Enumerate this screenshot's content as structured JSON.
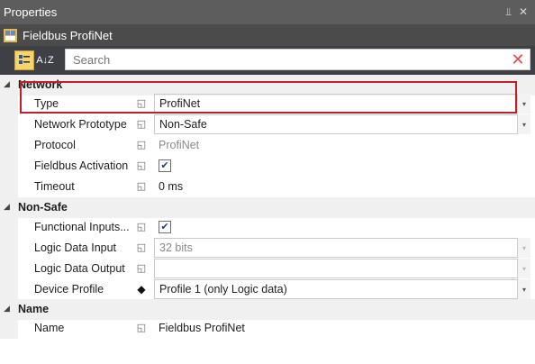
{
  "window": {
    "title": "Properties",
    "pin_glyph": "⫫",
    "close_glyph": "✕"
  },
  "object": {
    "name": "Fieldbus ProfiNet"
  },
  "toolbar": {
    "sort_label": "A↓Z"
  },
  "search": {
    "placeholder": "Search",
    "value": ""
  },
  "grid": {
    "categories": [
      {
        "label": "Network"
      },
      {
        "label": "Non-Safe"
      },
      {
        "label": "Name"
      }
    ],
    "network": [
      {
        "name": "Type",
        "value": "ProfiNet"
      },
      {
        "name": "Network Prototype",
        "value": "Non-Safe"
      },
      {
        "name": "Protocol",
        "value": "ProfiNet"
      },
      {
        "name": "Fieldbus Activation",
        "value": ""
      },
      {
        "name": "Timeout",
        "value": "0 ms"
      }
    ],
    "nonsafe": [
      {
        "name": "Functional Inputs...",
        "value": ""
      },
      {
        "name": "Logic Data Input",
        "value": "32 bits"
      },
      {
        "name": "Logic Data Output",
        "value": ""
      },
      {
        "name": "Device Profile",
        "value": "Profile 1 (only Logic data)"
      }
    ],
    "name": [
      {
        "name": "Name",
        "value": "Fieldbus ProfiNet"
      }
    ]
  },
  "colors": {
    "highlight": "#c0202a",
    "header": "#5d5d5d"
  },
  "icons": {
    "category-toggle": "triangle-down",
    "pin": "square-pin",
    "device-profile": "diamond"
  }
}
